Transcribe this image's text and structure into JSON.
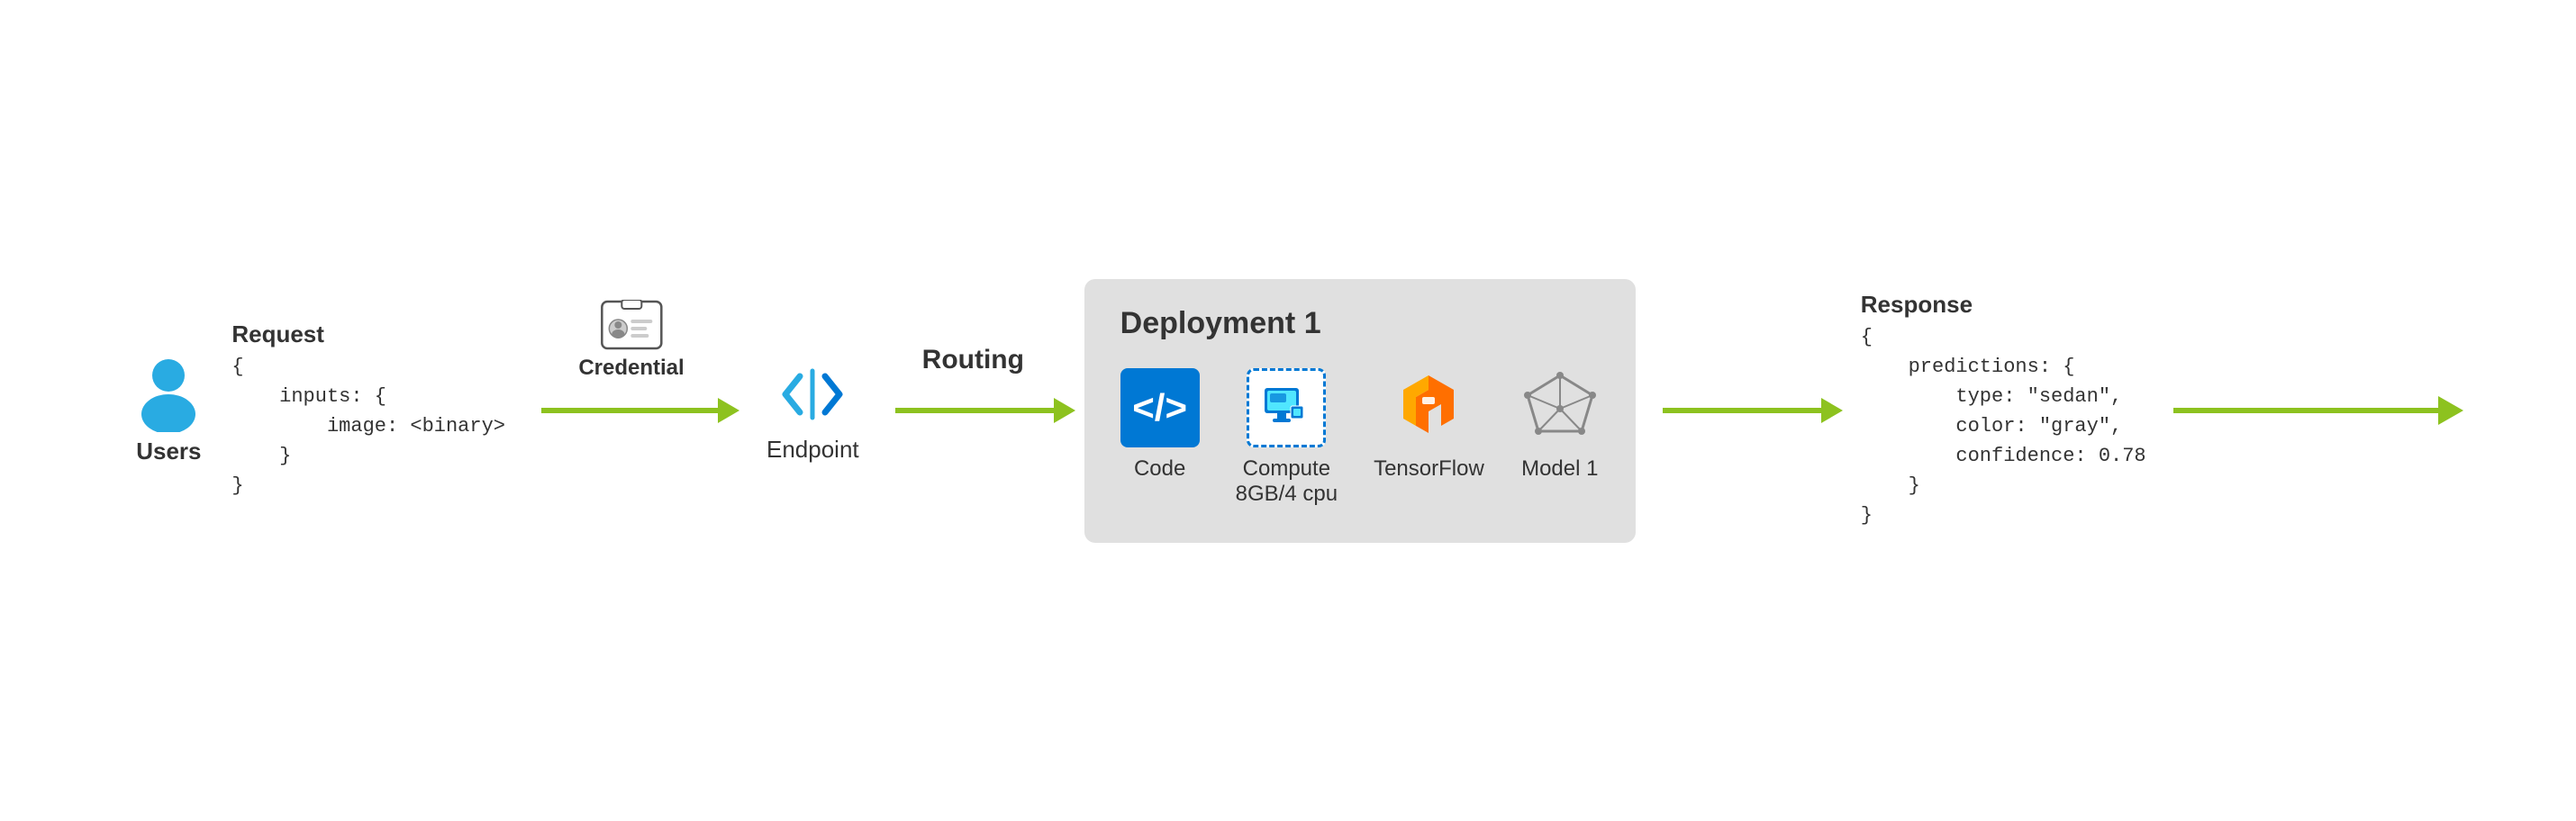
{
  "users": {
    "label": "Users"
  },
  "credential": {
    "label": "Credential"
  },
  "request": {
    "label": "Request",
    "code": "{\n    inputs: {\n        image: <binary>\n    }\n}"
  },
  "endpoint": {
    "label": "Endpoint"
  },
  "routing": {
    "label": "Routing"
  },
  "deployment": {
    "title": "Deployment 1",
    "items": [
      {
        "id": "code",
        "label": "Code"
      },
      {
        "id": "compute",
        "label": "Compute\n8GB/4 cpu"
      },
      {
        "id": "tensorflow",
        "label": "TensorFlow"
      },
      {
        "id": "model1",
        "label": "Model 1"
      }
    ]
  },
  "response": {
    "label": "Response",
    "code": "{\n    predictions: {\n        type: \"sedan\",\n        color: \"gray\",\n        confidence: 0.78\n    }\n}"
  },
  "colors": {
    "arrow": "#8dc21f",
    "azure_blue": "#0078d4",
    "tf_orange": "#FF6F00",
    "text_dark": "#333333",
    "deployment_bg": "#e0e0e0"
  }
}
